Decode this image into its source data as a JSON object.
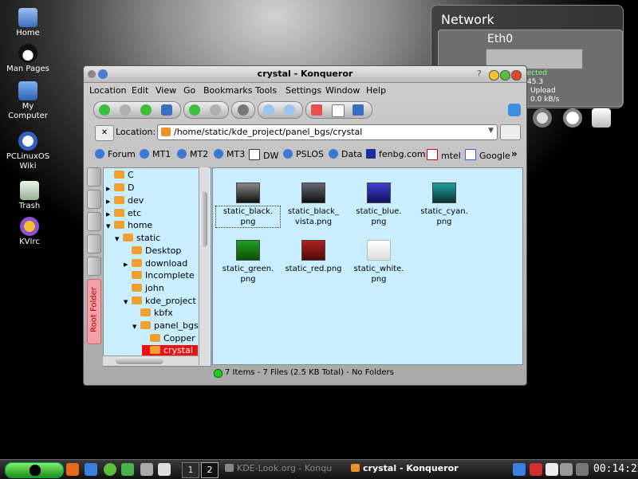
{
  "desktop": {
    "icons": [
      {
        "label": "Home",
        "icon": "home-icon"
      },
      {
        "label": "Man Pages",
        "icon": "tux-icon"
      },
      {
        "label": "My Computer",
        "icon": "computer-icon"
      },
      {
        "label": "PCLinuxOS Wiki",
        "icon": "wiki-icon"
      },
      {
        "label": "Trash",
        "icon": "trash-icon"
      },
      {
        "label": "KVIrc",
        "icon": "kvirc-icon"
      }
    ]
  },
  "network_widget": {
    "title": "Network",
    "interface": "Eth0",
    "status": "nected",
    "ip_fragment": "45.3",
    "upload_label": "Upload",
    "upload_speed": "0.0 kB/s"
  },
  "window": {
    "title": "crystal - Konqueror",
    "help": "?",
    "menu": [
      "Location",
      "Edit",
      "View",
      "Go",
      "Bookmarks",
      "Tools",
      "Settings",
      "Window",
      "Help"
    ],
    "location_label": "Location:",
    "location_value": "/home/static/kde_project/panel_bgs/crystal",
    "bookmarks": [
      "Forum",
      "MT1",
      "MT2",
      "MT3",
      "DW",
      "PSLOS",
      "Data",
      "fenbg.com",
      "mtel",
      "Google"
    ],
    "bookmarks_more": "»",
    "sidebar_tab": "Root Folder",
    "tree": [
      {
        "label": "C",
        "expander": ""
      },
      {
        "label": "D",
        "expander": "▶"
      },
      {
        "label": "dev",
        "expander": "▶"
      },
      {
        "label": "etc",
        "expander": "▶"
      },
      {
        "label": "home",
        "expander": "▼"
      },
      {
        "label": "static",
        "expander": "▼"
      },
      {
        "label": "Desktop",
        "expander": ""
      },
      {
        "label": "download",
        "expander": "▶"
      },
      {
        "label": "Incomplete",
        "expander": ""
      },
      {
        "label": "john",
        "expander": ""
      },
      {
        "label": "kde_project",
        "expander": "▼"
      },
      {
        "label": "kbfx",
        "expander": ""
      },
      {
        "label": "panel_bgs",
        "expander": "▼"
      },
      {
        "label": "Copper",
        "expander": ""
      },
      {
        "label": "crystal",
        "expander": "",
        "selected": true
      }
    ],
    "files": [
      {
        "line1": "static_black.",
        "line2": "png",
        "color": "#3a3a3a"
      },
      {
        "line1": "static_black_",
        "line2": "vista.png",
        "color": "#2a2a40"
      },
      {
        "line1": "static_blue.",
        "line2": "png",
        "color": "#2a2aa0"
      },
      {
        "line1": "static_cyan.",
        "line2": "png",
        "color": "#1a7070"
      },
      {
        "line1": "static_green.",
        "line2": "png",
        "color": "#1a8a1a"
      },
      {
        "line1": "static_red.png",
        "line2": "",
        "color": "#8a1a1a"
      },
      {
        "line1": "static_white.",
        "line2": "png",
        "color": "#f2f2f2"
      }
    ],
    "status": "7 Items - 7 Files (2.5 KB Total) - No Folders"
  },
  "taskbar": {
    "pagers": [
      "1",
      "2"
    ],
    "tasks": [
      {
        "label": "KDE-Look.org - Konqu",
        "active": false
      },
      {
        "label": "crystal - Konqueror",
        "active": true
      }
    ],
    "clock": "00:14:22"
  }
}
